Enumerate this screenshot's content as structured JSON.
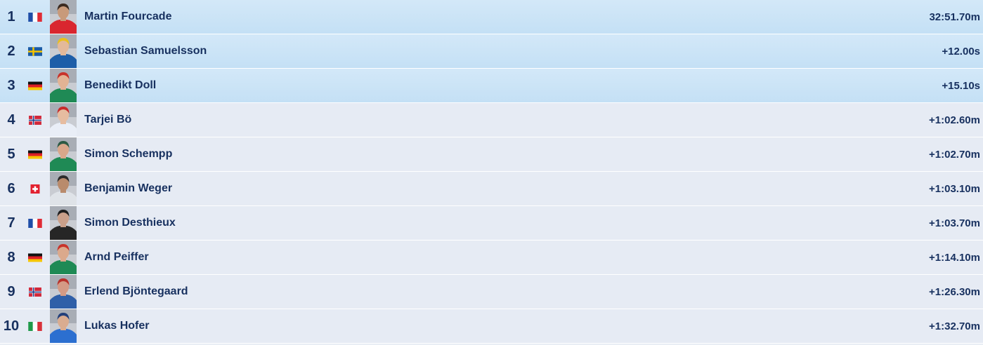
{
  "results": [
    {
      "rank": "1",
      "name": "Martin Fourcade",
      "time": "32:51.70m",
      "nation": "FRA",
      "flag_icon": "flag-france-icon",
      "podium": true,
      "jersey": "#d9262f",
      "skin": "#c89a7a",
      "hair": "#3a2a20"
    },
    {
      "rank": "2",
      "name": "Sebastian Samuelsson",
      "time": "+12.00s",
      "nation": "SWE",
      "flag_icon": "flag-sweden-icon",
      "podium": true,
      "jersey": "#1d5ea8",
      "skin": "#e3b99a",
      "hair": "#e8c020"
    },
    {
      "rank": "3",
      "name": "Benedikt Doll",
      "time": "+15.10s",
      "nation": "GER",
      "flag_icon": "flag-germany-icon",
      "podium": true,
      "jersey": "#1f8a55",
      "skin": "#e2b394",
      "hair": "#c8332b"
    },
    {
      "rank": "4",
      "name": "Tarjei Bö",
      "time": "+1:02.60m",
      "nation": "NOR",
      "flag_icon": "flag-norway-icon",
      "podium": false,
      "jersey": "#e9eef7",
      "skin": "#e6bca0",
      "hair": "#c82a2a"
    },
    {
      "rank": "5",
      "name": "Simon Schempp",
      "time": "+1:02.70m",
      "nation": "GER",
      "flag_icon": "flag-germany-icon",
      "podium": false,
      "jersey": "#1f8a55",
      "skin": "#d9a78a",
      "hair": "#2c5a44"
    },
    {
      "rank": "6",
      "name": "Benjamin Weger",
      "time": "+1:03.10m",
      "nation": "SUI",
      "flag_icon": "flag-switzerland-icon",
      "podium": false,
      "jersey": "#dfe3e8",
      "skin": "#b98b6c",
      "hair": "#2b2b2b"
    },
    {
      "rank": "7",
      "name": "Simon Desthieux",
      "time": "+1:03.70m",
      "nation": "FRA",
      "flag_icon": "flag-france-icon",
      "podium": false,
      "jersey": "#262626",
      "skin": "#caa08a",
      "hair": "#1e1e1e"
    },
    {
      "rank": "8",
      "name": "Arnd Peiffer",
      "time": "+1:14.10m",
      "nation": "GER",
      "flag_icon": "flag-germany-icon",
      "podium": false,
      "jersey": "#1f8a55",
      "skin": "#dba98c",
      "hair": "#c8332b"
    },
    {
      "rank": "9",
      "name": "Erlend Bjöntegaard",
      "time": "+1:26.30m",
      "nation": "NOR",
      "flag_icon": "flag-norway-icon",
      "podium": false,
      "jersey": "#2f5fa8",
      "skin": "#d49a85",
      "hair": "#b8322b"
    },
    {
      "rank": "10",
      "name": "Lukas Hofer",
      "time": "+1:32.70m",
      "nation": "ITA",
      "flag_icon": "flag-italy-icon",
      "podium": false,
      "jersey": "#2c6fd0",
      "skin": "#d9ac90",
      "hair": "#23407a"
    }
  ]
}
